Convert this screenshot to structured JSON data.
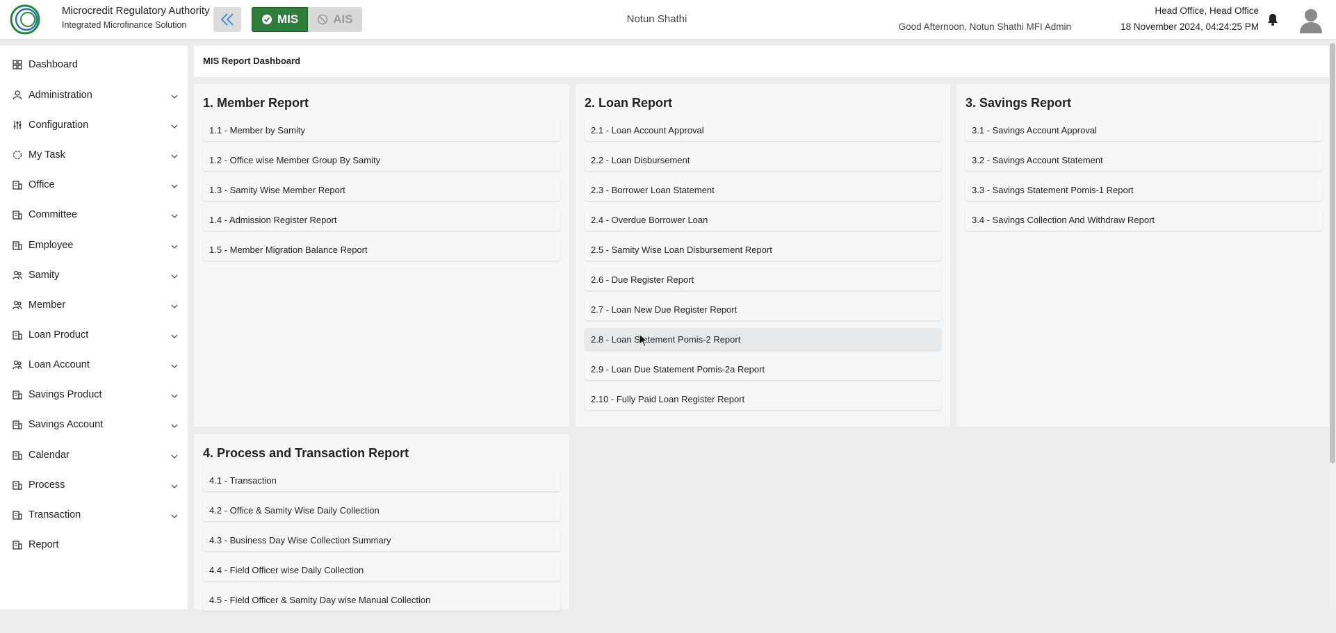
{
  "header": {
    "logo_text": "Microcredit Regulatory Authority",
    "brand_title": "Microcredit Regulatory Authority",
    "brand_subtitle": "Integrated Microfinance Solution",
    "mode_mis": "MIS",
    "mode_ais": "AIS",
    "org_name": "Notun Shathi",
    "greeting": "Good Afternoon, Notun Shathi MFI Admin",
    "office": "Head Office, Head Office",
    "datetime": "18 November 2024, 04:24:25 PM"
  },
  "sidebar": {
    "items": [
      {
        "label": "Dashboard",
        "icon": "dashboard-icon",
        "chevron": false
      },
      {
        "label": "Administration",
        "icon": "admin-icon",
        "chevron": true
      },
      {
        "label": "Configuration",
        "icon": "config-icon",
        "chevron": true
      },
      {
        "label": "My Task",
        "icon": "task-icon",
        "chevron": true
      },
      {
        "label": "Office",
        "icon": "office-icon",
        "chevron": true
      },
      {
        "label": "Committee",
        "icon": "committee-icon",
        "chevron": true
      },
      {
        "label": "Employee",
        "icon": "employee-icon",
        "chevron": true
      },
      {
        "label": "Samity",
        "icon": "samity-icon",
        "chevron": true
      },
      {
        "label": "Member",
        "icon": "member-icon",
        "chevron": true
      },
      {
        "label": "Loan Product",
        "icon": "loan-product-icon",
        "chevron": true
      },
      {
        "label": "Loan Account",
        "icon": "loan-account-icon",
        "chevron": true
      },
      {
        "label": "Savings Product",
        "icon": "savings-product-icon",
        "chevron": true
      },
      {
        "label": "Savings Account",
        "icon": "savings-account-icon",
        "chevron": true
      },
      {
        "label": "Calendar",
        "icon": "calendar-icon",
        "chevron": true
      },
      {
        "label": "Process",
        "icon": "process-icon",
        "chevron": true
      },
      {
        "label": "Transaction",
        "icon": "transaction-icon",
        "chevron": true
      },
      {
        "label": "Report",
        "icon": "report-icon",
        "chevron": false
      }
    ]
  },
  "main": {
    "breadcrumb": "MIS Report Dashboard",
    "sections": [
      {
        "title": "1. Member Report",
        "items": [
          "1.1 - Member by Samity",
          "1.2 - Office wise Member Group By Samity",
          "1.3 - Samity Wise Member Report",
          "1.4 - Admission Register Report",
          "1.5 - Member Migration Balance Report"
        ]
      },
      {
        "title": "2. Loan Report",
        "items": [
          "2.1 - Loan Account Approval",
          "2.2 - Loan Disbursement",
          "2.3 - Borrower Loan Statement",
          "2.4 - Overdue Borrower Loan",
          "2.5 - Samity Wise Loan Disbursement Report",
          "2.6 - Due Register Report",
          "2.7 - Loan New Due Register Report",
          "2.8 - Loan Statement Pomis-2 Report",
          "2.9 - Loan Due Statement Pomis-2a Report",
          "2.10 - Fully Paid Loan Register Report"
        ]
      },
      {
        "title": "3. Savings Report",
        "items": [
          "3.1 - Savings Account Approval",
          "3.2 - Savings Account Statement",
          "3.3 - Savings Statement Pomis-1 Report",
          "3.4 - Savings Collection And Withdraw Report"
        ]
      },
      {
        "title": "4. Process and Transaction Report",
        "items": [
          "4.1 - Transaction",
          "4.2 - Office & Samity Wise Daily Collection",
          "4.3 - Business Day Wise Collection Summary",
          "4.4 - Field Officer wise Daily Collection",
          "4.5 - Field Officer & Samity Day wise Manual Collection"
        ]
      }
    ]
  },
  "colors": {
    "mis_active": "#2f7d3a",
    "ais_inactive": "#d9d9d9",
    "card_bg": "#f7f7f7",
    "hover_item_bg": "#e8e9eb",
    "page_bg": "#ececec"
  }
}
